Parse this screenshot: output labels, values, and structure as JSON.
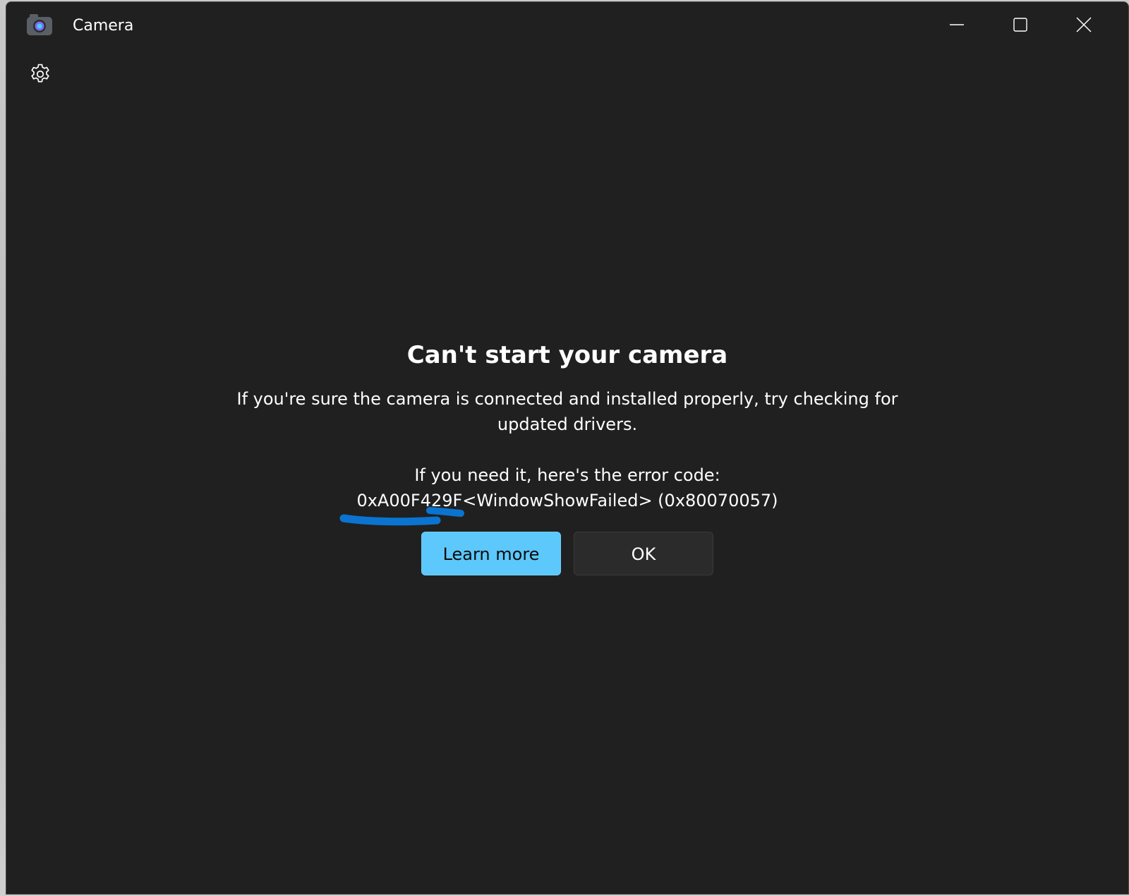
{
  "window": {
    "title": "Camera",
    "icon": "camera-app-icon",
    "controls": {
      "minimize_icon": "minimize-icon",
      "maximize_icon": "maximize-icon",
      "close_icon": "close-icon"
    }
  },
  "toolbar": {
    "settings_icon": "gear-icon"
  },
  "error": {
    "heading": "Can't start your camera",
    "description": "If you're sure the camera is connected and installed properly, try checking for updated drivers.",
    "code_label": "If you need it, here's the error code:",
    "code": "0xA00F429F<WindowShowFailed> (0x80070057)"
  },
  "actions": {
    "learn_more": "Learn more",
    "ok": "OK"
  },
  "colors": {
    "background": "#202020",
    "accent_button": "#5cc8fb",
    "secondary_button": "#2b2b2b",
    "annotation": "#0a74d0"
  }
}
